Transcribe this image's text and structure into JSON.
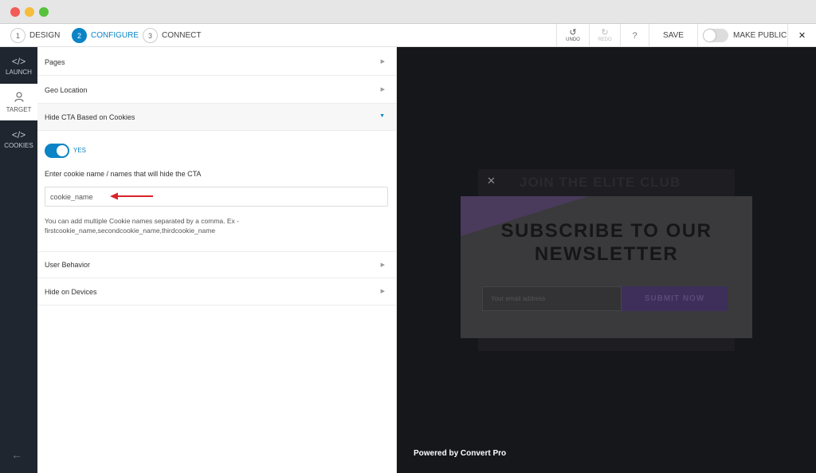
{
  "steps": [
    {
      "num": "1",
      "label": "DESIGN"
    },
    {
      "num": "2",
      "label": "CONFIGURE"
    },
    {
      "num": "3",
      "label": "CONNECT"
    }
  ],
  "toolbar": {
    "undo_label": "UNDO",
    "redo_label": "REDO",
    "help_label": "?",
    "save_label": "SAVE",
    "make_public_label": "MAKE PUBLIC",
    "close_label": "✕",
    "make_public_enabled": false
  },
  "rail": {
    "items": [
      {
        "label": "LAUNCH",
        "icon": "code-icon"
      },
      {
        "label": "TARGET",
        "icon": "user-icon"
      },
      {
        "label": "COOKIES",
        "icon": "code-icon"
      }
    ],
    "active_index": 1,
    "back_icon": "arrow-left-icon"
  },
  "panel": {
    "sections": [
      {
        "title": "Pages",
        "expanded": false
      },
      {
        "title": "Geo Location",
        "expanded": false
      },
      {
        "title": "Hide CTA Based on Cookies",
        "expanded": true
      },
      {
        "title": "User Behavior",
        "expanded": false
      },
      {
        "title": "Hide on Devices",
        "expanded": false
      }
    ],
    "cookies": {
      "toggle_label": "YES",
      "toggle_on": true,
      "field_label": "Enter cookie name / names that will hide the CTA",
      "input_value": "cookie_name",
      "helper_text": "You can add multiple Cookie names separated by a comma. Ex - firstcookie_name,secondcookie_name,thirdcookie_name"
    }
  },
  "preview": {
    "back_heading": "JOIN THE ELITE CLUB",
    "close_glyph": "✕",
    "title_line1": "SUBSCRIBE TO OUR",
    "title_line2": "NEWSLETTER",
    "email_placeholder": "Your email address",
    "submit_label": "SUBMIT NOW",
    "powered_by": "Powered by Convert Pro"
  },
  "colors": {
    "accent": "#0a84c6",
    "rail_bg": "#1f2630",
    "preview_bg": "#15171b",
    "arrow": "#d9232a"
  }
}
